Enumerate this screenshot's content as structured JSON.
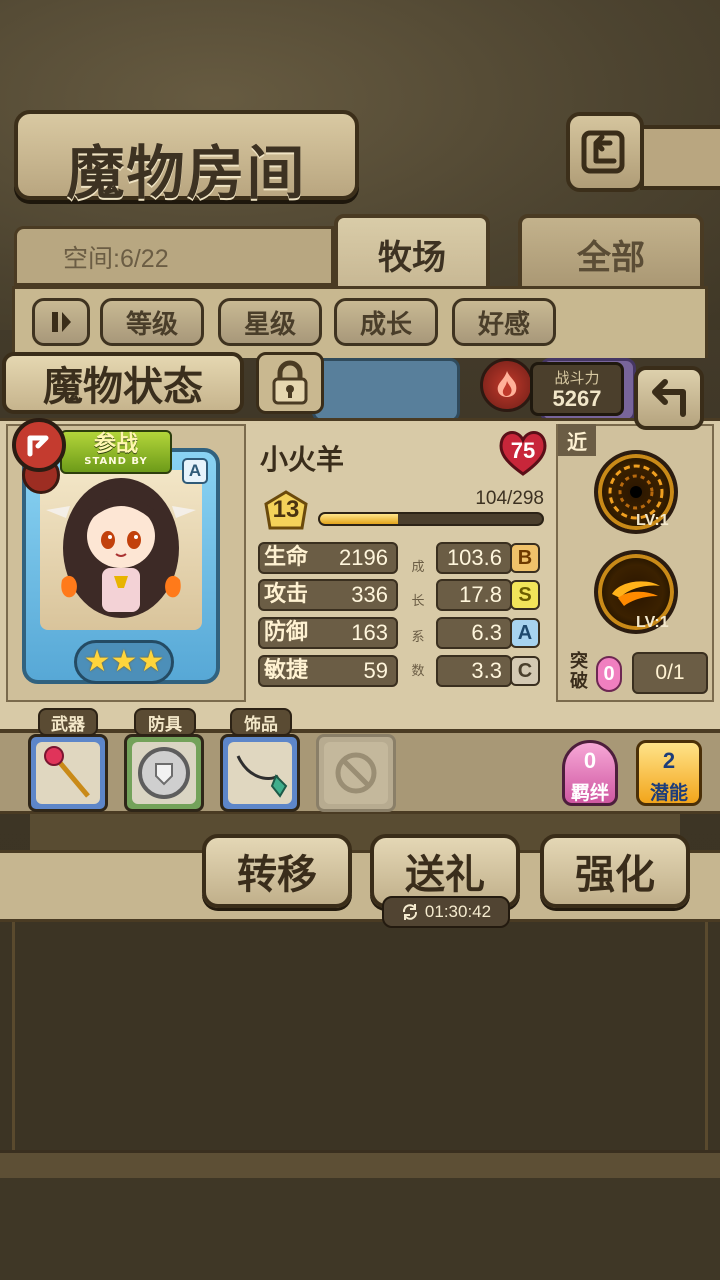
{
  "header": {
    "title": "魔物房间",
    "space_label": "空间:6/22"
  },
  "tabs": [
    {
      "label": "牧场",
      "active": true
    },
    {
      "label": "全部",
      "active": false
    }
  ],
  "sort_buttons": [
    "等级",
    "星级",
    "成长",
    "好感"
  ],
  "status_title": "魔物状态",
  "power": {
    "label": "战斗力",
    "value": "5267"
  },
  "card": {
    "standby_cn": "参战",
    "standby_en": "STAND BY",
    "rank": "A",
    "stars": [
      "★",
      "★",
      "★"
    ]
  },
  "monster": {
    "name": "小火羊",
    "affection": "75",
    "level": "13",
    "exp_text": "104/298",
    "exp_progress": 0.35
  },
  "stats": [
    {
      "name": "生命",
      "value": "2196",
      "growth": "103.6",
      "grade": "B"
    },
    {
      "name": "攻击",
      "value": "336",
      "growth": "17.8",
      "grade": "S"
    },
    {
      "name": "防御",
      "value": "163",
      "growth": "6.3",
      "grade": "A"
    },
    {
      "name": "敏捷",
      "value": "59",
      "growth": "3.3",
      "grade": "C"
    }
  ],
  "growth_label": [
    "成",
    "长",
    "系",
    "数"
  ],
  "skills": {
    "tag": "近",
    "items": [
      {
        "icon": "dark-vortex-icon",
        "level": "LV:1"
      },
      {
        "icon": "fire-whirl-icon",
        "level": "LV:1"
      }
    ]
  },
  "breakthrough": {
    "label": "突破",
    "count": "0",
    "progress": "0/1"
  },
  "equipment": {
    "weapon_label": "武器",
    "armor_label": "防具",
    "accessory_label": "饰品"
  },
  "bond": {
    "count": "0",
    "label": "羁绊"
  },
  "potential": {
    "count": "2",
    "label": "潜能"
  },
  "actions": {
    "transfer": "转移",
    "gift": "送礼",
    "enhance": "强化",
    "timer": "01:30:42"
  },
  "colors": {
    "parchment": "#d8caa7",
    "border": "#4a3b23",
    "exp_fill": "#e3a51d",
    "heart": "#c8263a"
  }
}
